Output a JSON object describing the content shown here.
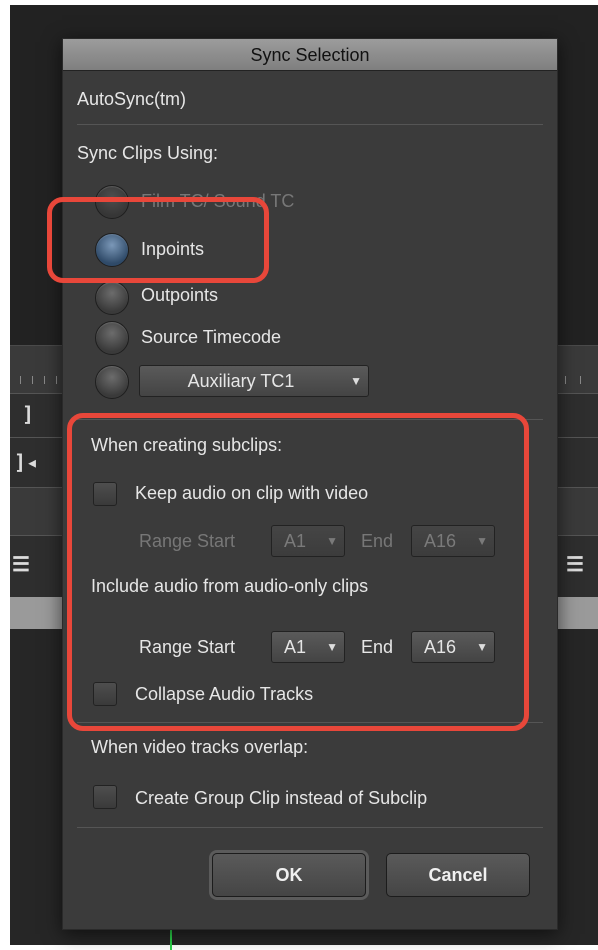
{
  "dialog": {
    "title": "Sync Selection",
    "autosync_label": "AutoSync(tm)",
    "sync_using_label": "Sync Clips Using:",
    "options": {
      "film_tc": "Film TC/ Sound TC",
      "inpoints": "Inpoints",
      "outpoints": "Outpoints",
      "source_tc": "Source Timecode",
      "aux_tc": "Auxiliary TC1"
    },
    "subclips": {
      "heading": "When creating subclips:",
      "keep_audio": "Keep audio on clip with video",
      "range_start_label": "Range Start",
      "range_start_value": "A1",
      "end_label": "End",
      "end_value": "A16",
      "include_audio": "Include audio from audio-only clips",
      "range2_start_label": "Range Start",
      "range2_start_value": "A1",
      "end2_label": "End",
      "end2_value": "A16",
      "collapse": "Collapse Audio Tracks"
    },
    "overlap": {
      "heading": "When video tracks overlap:",
      "group_clip": "Create Group Clip instead of Subclip"
    },
    "buttons": {
      "ok": "OK",
      "cancel": "Cancel"
    }
  },
  "background_glyphs": {
    "g1": "]",
    "g2": "]◂",
    "g3": "☰",
    "g4": "☰"
  },
  "colors": {
    "highlight": "#e8473a",
    "selected_radio": "#4e6d90",
    "dialog_bg": "#3b3b3b"
  }
}
